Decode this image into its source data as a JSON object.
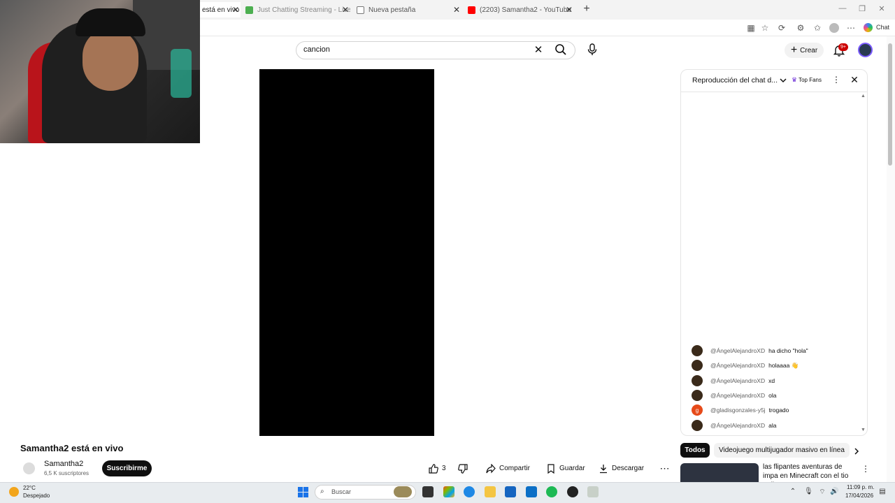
{
  "browser": {
    "tabs": [
      {
        "label": "está en vivo",
        "active": true,
        "favicon_color": "#ff0000"
      },
      {
        "label": "Just Chatting Streaming - Live Str",
        "active": false,
        "favicon_color": "#4caf50"
      },
      {
        "label": "Nueva pestaña",
        "active": false,
        "favicon_color": "#888888"
      },
      {
        "label": "(2203) Samantha2 - YouTube",
        "active": false,
        "favicon_color": "#ff0000"
      }
    ],
    "new_tab": "+",
    "chat_button": "Chat"
  },
  "youtube": {
    "search": {
      "value": "cancion"
    },
    "create_label": "Crear",
    "notification_badge": "9+"
  },
  "video": {
    "title": "Samantha2 está en vivo",
    "channel_name": "Samantha2",
    "subscribers": "6,5 K suscriptores",
    "subscribe_label": "Suscribirme",
    "like_count": "3",
    "share_label": "Compartir",
    "save_label": "Guardar",
    "download_label": "Descargar"
  },
  "chat": {
    "title": "Reproducción del chat d...",
    "top_fans_label": "Top Fans",
    "messages": [
      {
        "author": "@ÁngelAlejandroXD",
        "text": "ha dicho \"hola\"",
        "avatar_color": "#3a2a1a"
      },
      {
        "author": "@ÁngelAlejandroXD",
        "text": "holaaaa 👋",
        "avatar_color": "#3a2a1a"
      },
      {
        "author": "@ÁngelAlejandroXD",
        "text": "xd",
        "avatar_color": "#3a2a1a"
      },
      {
        "author": "@ÁngelAlejandroXD",
        "text": "ola",
        "avatar_color": "#3a2a1a"
      },
      {
        "author": "@gladisgonzales-y5j",
        "text": "trogado",
        "avatar_color": "#e64a19",
        "initial": "g"
      },
      {
        "author": "@ÁngelAlejandroXD",
        "text": "ala",
        "avatar_color": "#3a2a1a"
      }
    ]
  },
  "chips": {
    "all": "Todos",
    "game": "Videojuego multijugador masivo en línea"
  },
  "recommendation": {
    "title": "las flipantes aventuras de impa en Minecraft con el tio Felipe"
  },
  "taskbar": {
    "weather_temp": "22°C",
    "weather_desc": "Despejado",
    "search_placeholder": "Buscar",
    "time": "11:09 p. m.",
    "date": "17/04/2026"
  },
  "colors": {
    "accent": "#0f0f0f",
    "notification": "#cc0000",
    "top_fans_crown": "#6a2bd6",
    "windows_blue": "#1a73e8"
  }
}
